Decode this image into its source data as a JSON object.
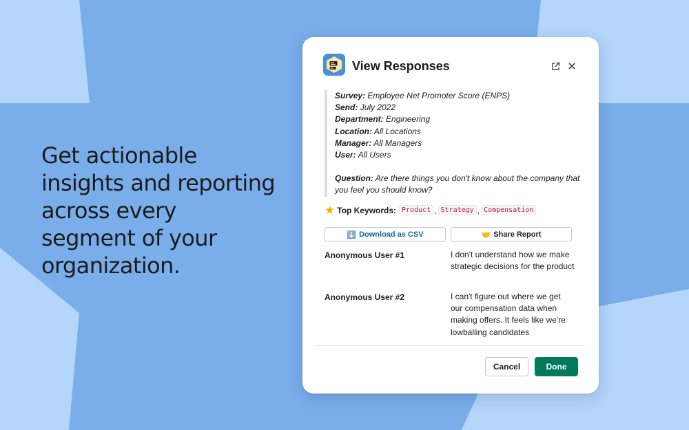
{
  "colors": {
    "background_light": "#b4d6fa",
    "background_shape": "#7aaeea",
    "csv_text": "#1264a3",
    "done_button": "#007a5a",
    "code_text": "#c01343"
  },
  "headline": "Get actionable insights and reporting across every segment of your organization.",
  "modal": {
    "app_icon": "survey-app-icon",
    "title": "View Responses",
    "open_icon": "external-link-icon",
    "close_icon": "close-icon",
    "details": [
      {
        "label": "Survey:",
        "value": "Employee Net Promoter Score (ENPS)"
      },
      {
        "label": "Send:",
        "value": "July 2022"
      },
      {
        "label": "Department:",
        "value": "Engineering"
      },
      {
        "label": "Location:",
        "value": "All Locations"
      },
      {
        "label": "Manager:",
        "value": "All Managers"
      },
      {
        "label": "User:",
        "value": "All Users"
      }
    ],
    "question": {
      "label": "Question:",
      "value": "Are there things you don't know about the company that you feel you should know?"
    },
    "keywords": {
      "icon": "star-icon",
      "label": "Top Keywords:",
      "items": [
        "Product",
        "Strategy",
        "Compensation"
      ],
      "separator": ","
    },
    "download_button": {
      "icon": "⬇️",
      "label": "Download as CSV"
    },
    "share_button": {
      "icon": "🤝",
      "label": "Share Report"
    },
    "responses": [
      {
        "user": "Anonymous User #1",
        "text": "I don't understand how we make strategic decisions for the product"
      },
      {
        "user": "Anonymous User #2",
        "text": "I can't figure out where we get our compensation data when making offers. It feels like we're lowballing candidates"
      }
    ],
    "cancel_label": "Cancel",
    "done_label": "Done"
  }
}
